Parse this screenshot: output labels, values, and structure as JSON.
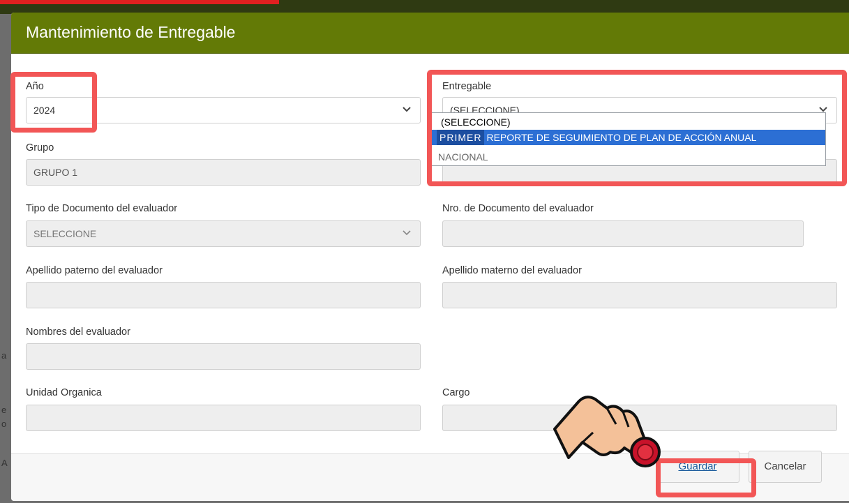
{
  "modal": {
    "title": "Mantenimiento de Entregable",
    "header_color": "#637a06"
  },
  "fields": {
    "anio": {
      "label": "Año",
      "value": "2024"
    },
    "entregable": {
      "label": "Entregable",
      "value": "(SELECCIONE)",
      "dropdown_options": [
        {
          "label": "(SELECCIONE)",
          "selected": false
        },
        {
          "prefix": "PRIMER",
          "label": "REPORTE DE SEGUIMIENTO DE PLAN DE ACCIÓN ANUAL",
          "selected": true
        },
        {
          "label": "NACIONAL",
          "selected": false
        }
      ]
    },
    "grupo": {
      "label": "Grupo",
      "value": "GRUPO 1"
    },
    "tipo_documento": {
      "label": "Tipo de Documento del evaluador",
      "value": "SELECCIONE"
    },
    "nro_documento": {
      "label": "Nro. de Documento del evaluador",
      "value": ""
    },
    "apellido_paterno": {
      "label": "Apellido paterno del evaluador",
      "value": ""
    },
    "apellido_materno": {
      "label": "Apellido materno del evaluador",
      "value": ""
    },
    "nombres": {
      "label": "Nombres del evaluador",
      "value": ""
    },
    "unidad_organica": {
      "label": "Unidad Organica",
      "value": ""
    },
    "cargo": {
      "label": "Cargo",
      "value": ""
    }
  },
  "footer": {
    "save_label": "Guardar",
    "cancel_label": "Cancelar"
  },
  "background": {
    "left_fragments": [
      "a",
      "e",
      "o",
      "A"
    ]
  },
  "colors": {
    "highlight": "#f25656",
    "selected_option": "#2c6fd4"
  }
}
